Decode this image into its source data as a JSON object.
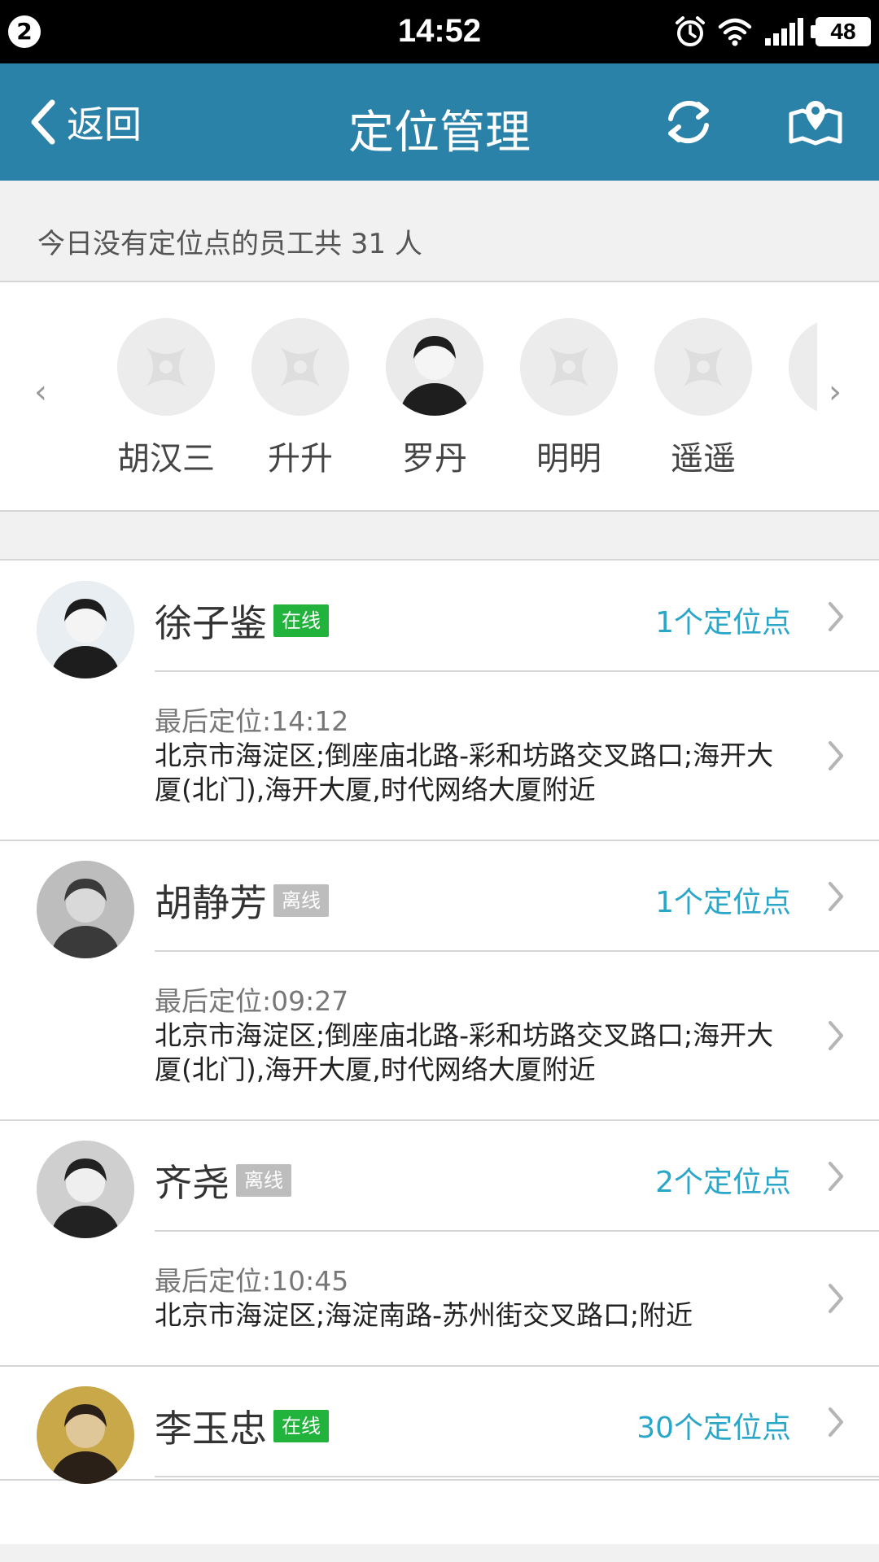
{
  "status_bar": {
    "notification_count": "2",
    "time": "14:52",
    "battery": "48",
    "icons": [
      "alarm-icon",
      "wifi-icon",
      "signal-icon",
      "battery-icon"
    ]
  },
  "nav": {
    "back_label": "返回",
    "title": "定位管理",
    "refresh_icon": "refresh-icon",
    "map_icon": "map-pin-icon"
  },
  "summary": {
    "text": "今日没有定位点的员工共 31 人"
  },
  "carousel": {
    "left_arrow": "‹",
    "right_arrow": "›",
    "people": [
      {
        "name": "胡汉三",
        "has_photo": false
      },
      {
        "name": "升升",
        "has_photo": false
      },
      {
        "name": "罗丹",
        "has_photo": true
      },
      {
        "name": "明明",
        "has_photo": false
      },
      {
        "name": "遥遥",
        "has_photo": false
      },
      {
        "name": "",
        "has_photo": false
      }
    ]
  },
  "employees": [
    {
      "name": "徐子鉴",
      "status": "在线",
      "online": true,
      "count": "1个定位点",
      "last_label": "最后定位:",
      "last_time": "14:12",
      "address": "北京市海淀区;倒座庙北路-彩和坊路交叉路口;海开大厦(北门),海开大厦,时代网络大厦附近"
    },
    {
      "name": "胡静芳",
      "status": "离线",
      "online": false,
      "count": "1个定位点",
      "last_label": "最后定位:",
      "last_time": "09:27",
      "address": "北京市海淀区;倒座庙北路-彩和坊路交叉路口;海开大厦(北门),海开大厦,时代网络大厦附近"
    },
    {
      "name": "齐尧",
      "status": "离线",
      "online": false,
      "count": "2个定位点",
      "last_label": "最后定位:",
      "last_time": "10:45",
      "address": "北京市海淀区;海淀南路-苏州街交叉路口;附近"
    },
    {
      "name": "李玉忠",
      "status": "在线",
      "online": true,
      "count": "30个定位点"
    }
  ],
  "colors": {
    "nav_bg": "#2b82a8",
    "accent": "#2aa6c8",
    "online": "#22b33c",
    "offline": "#bdbdbd"
  }
}
